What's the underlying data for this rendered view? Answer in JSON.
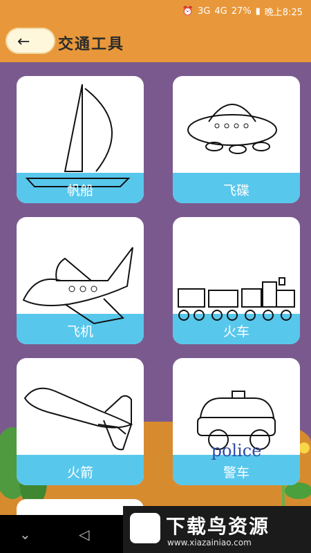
{
  "status": {
    "time": "晚上8:25",
    "battery": "27%",
    "signals": [
      "3G",
      "4G"
    ]
  },
  "appbar": {
    "title": "交通工具",
    "back_icon": "back-arrow-icon"
  },
  "cards": [
    {
      "label": "帆船"
    },
    {
      "label": "飞碟"
    },
    {
      "label": "飞机"
    },
    {
      "label": "火车"
    },
    {
      "label": "火箭"
    },
    {
      "label": "警车",
      "police_text": "police"
    }
  ],
  "nav": {
    "back_symbol": "◁",
    "down_symbol": "⌄"
  },
  "watermark": {
    "title": "下载鸟资源",
    "url": "www.xiazainiao.com"
  },
  "colors": {
    "header": "#e8983a",
    "background": "#7a5a8e",
    "water": "#58c7ec"
  }
}
